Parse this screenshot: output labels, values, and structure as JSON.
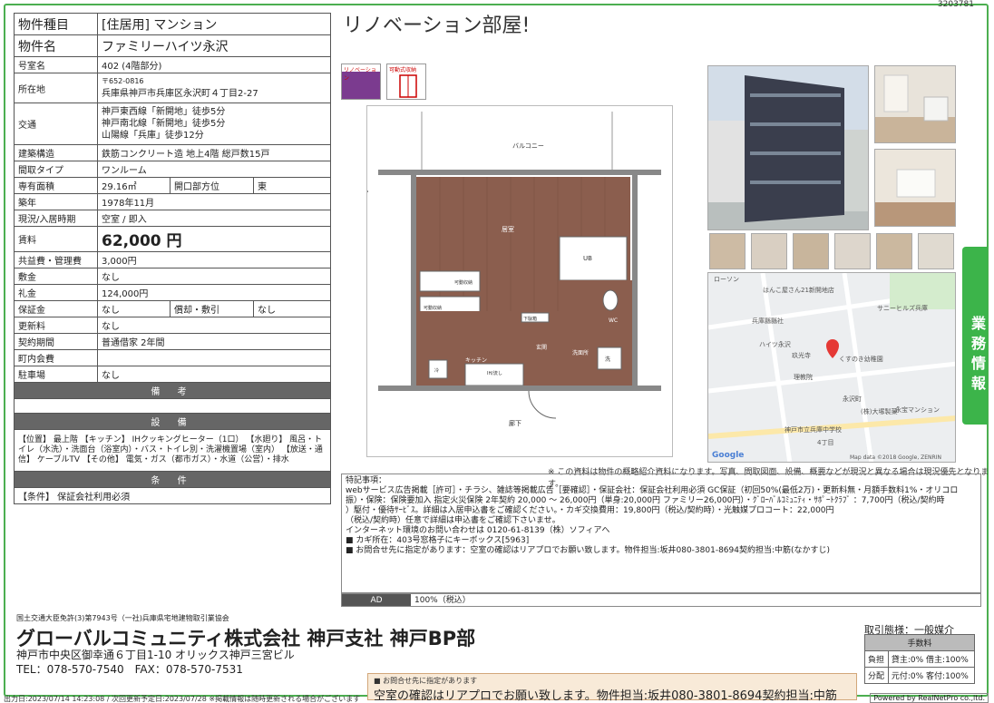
{
  "doc_id": "3203781",
  "headline": "リノベーション部屋!",
  "spec": {
    "type_label": "物件種目",
    "type_value": "[住居用] マンション",
    "name_label": "物件名",
    "name_value": "ファミリーハイツ永沢",
    "room_label": "号室名",
    "room_value": "402 (4階部分)",
    "addr_label": "所在地",
    "zip": "〒652-0816",
    "addr_value": "兵庫県神戸市兵庫区永沢町４丁目2-27",
    "traffic_label": "交通",
    "traffic": [
      "神戸東西線「新開地」徒歩5分",
      "神戸南北線「新開地」徒歩5分",
      "山陽線「兵庫」徒歩12分"
    ],
    "struct_label": "建築構造",
    "struct_value": "鉄筋コンクリート造 地上4階 総戸数15戸",
    "layout_label": "間取タイプ",
    "layout_value": "ワンルーム",
    "area_label": "専有面積",
    "area_value": "29.16㎡",
    "dir_label": "開口部方位",
    "dir_value": "東",
    "built_label": "築年",
    "built_value": "1978年11月",
    "status_label": "現況/入居時期",
    "status_value": "空室 / 即入",
    "rent_label": "賃料",
    "rent_value": "62,000 円",
    "common_label": "共益費・管理費",
    "common_value": "3,000円",
    "deposit_label": "敷金",
    "deposit_value": "なし",
    "key_label": "礼金",
    "key_value": "124,000円",
    "guarantee_label": "保証金",
    "guarantee_value": "なし",
    "amort_label": "償却・敷引",
    "amort_value": "なし",
    "renew_label": "更新料",
    "renew_value": "なし",
    "contract_label": "契約期間",
    "contract_value": "普通借家 2年間",
    "assoc_label": "町内会費",
    "assoc_value": "",
    "parking_label": "駐車場",
    "parking_value": "なし",
    "remarks_head": "備 考",
    "equip_head": "設 備",
    "equip_text": "【位置】 最上階 【キッチン】 IHクッキングヒーター（1口） 【水廻り】 風呂・トイレ（水洗）・洗面台（浴室内）・バス・トイレ別・洗濯機置場（室内） 【放送・通信】 ケーブルTV 【その他】 電気・ガス（都市ガス）・水道（公営）・排水",
    "cond_head": "条 件",
    "cond_text": "【条件】 保証会社利用必須"
  },
  "icons": {
    "reno": "リノベーション",
    "storage": "可動式収納"
  },
  "plan_labels": {
    "balcony": "バルコニー",
    "living": "居室",
    "ub": "UB",
    "wc": "WC",
    "wash": "洗面所",
    "entrance": "玄関",
    "kitchen": "キッチン",
    "hall": "廊下",
    "storage1": "可動収納",
    "storage2": "可動収納",
    "shoebox": "下駄箱",
    "washer": "洗",
    "kitchen_sink": "IH/流し",
    "fridge": "冷"
  },
  "map": {
    "labels": [
      "はんこ屋さん21新開地店",
      "兵庫縣縣社",
      "ハイツ永沢",
      "玖光寺",
      "理教院",
      "くすのき幼稚園",
      "永沢町",
      "サニーヒルズ兵庫",
      "(株)大塚製薬",
      "永宝マンション",
      "神戸市立兵庫中学校",
      "4丁目",
      "Google",
      "Map data ©2018 Google, ZENRIN",
      "ローソン"
    ]
  },
  "side_tab": "業務情報",
  "disclaimer": "※ この資料は物件の概略紹介資料になります。写真、間取図面、設備、概要などが現況と異なる場合は現況優先となります。",
  "notes": {
    "title": "特記事項：",
    "lines": [
      "webサービス広告掲載［許可］・チラシ、雑誌等掲載広告［要確認］・保証会社：保証会社利用必須 GC保証（初回50%(最低2万)・更新料無・月額手数料1%・オリコロ",
      "振）・保険：保険要加入 指定火災保険 2年契約 20,000 ～ 26,000円（単身:20,000円 ファミリー26,000円）・ｸﾞﾛｰﾊﾞﾙｺﾐｭﾆﾃｨ・ｻﾎﾟｰﾄｸﾗﾌﾞ ：7,700円（税込/契約時",
      "）駆付・優待ｻｰﾋﾞｽ。詳細は入居申込書をご確認ください。・カギ交換費用：19,800円（税込/契約時）・光触媒プロコート：22,000円",
      "（税込/契約時）任意で詳細は申込書をご確認下さいませ。",
      "インターネット環境のお問い合わせは 0120-61-8139（株）ソフィアへ",
      "■ カギ所在：403号窓格子にキーボックス[5963]",
      "■ お問合せ先に指定があります：空室の確認はリアプロでお願い致します。物件担当:坂井080-3801-8694契約担当:中筋(なかすじ)"
    ]
  },
  "ad": {
    "label": "AD",
    "value": "100%（税込）"
  },
  "footer": {
    "license": "国土交通大臣免許(3)第7943号（一社)兵庫県宅地建物取引業協会",
    "company": "グローバルコミュニティ株式会社 神戸支社 神戸BP部",
    "address": "神戸市中央区御幸通６丁目1-10 オリックス神戸三宮ビル",
    "phone": "TEL：078-570-7540　FAX：078-570-7531",
    "trade": "取引態様：一般媒介",
    "fee_head": "手数料",
    "fee_rows": [
      {
        "k": "負担",
        "v": "貸主:0% 借主:100%"
      },
      {
        "k": "分配",
        "v": "元付:0% 客付:100%"
      }
    ],
    "output": "出力日:2023/07/14 14:23:08 / 次回更新予定日:2023/07/28 ※掲載情報は随時更新される場合がございます",
    "powered": "Powered by RealNetPro co.,ltd."
  },
  "tooltip": {
    "small": "■ お問合せ先に指定があります",
    "main": "空室の確認はリアプロでお願い致します。物件担当:坂井080-3801-8694契約担当:中筋(なかすじ)"
  }
}
